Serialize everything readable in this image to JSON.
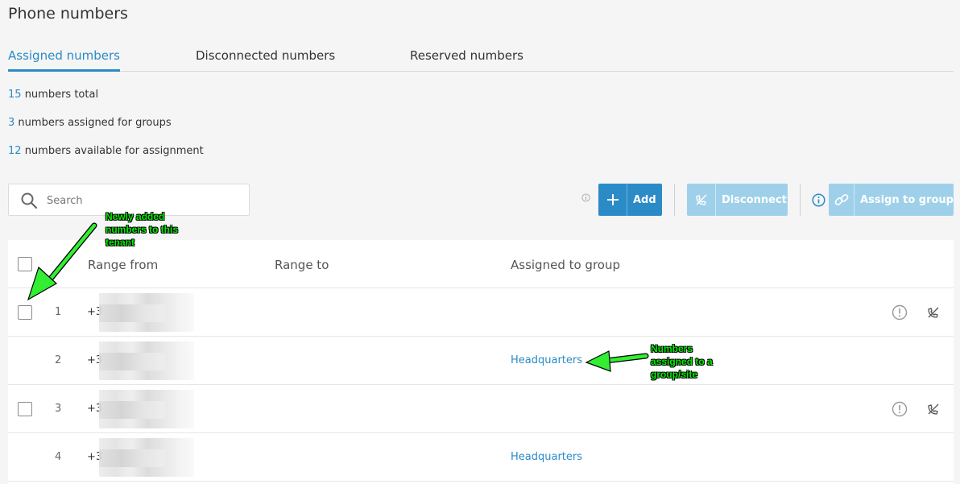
{
  "page": {
    "title": "Phone numbers"
  },
  "tabs": [
    {
      "label": "Assigned numbers",
      "active": true
    },
    {
      "label": "Disconnected numbers",
      "active": false
    },
    {
      "label": "Reserved numbers",
      "active": false
    }
  ],
  "stats": [
    {
      "value": "15",
      "text": "numbers total"
    },
    {
      "value": "3",
      "text": "numbers assigned for groups"
    },
    {
      "value": "12",
      "text": "numbers available for assignment"
    }
  ],
  "search": {
    "placeholder": "Search",
    "value": "",
    "icon": "search-icon"
  },
  "toolbar": {
    "add_label": "Add",
    "disconnect_label": "Disconnect",
    "assign_label": "Assign to group",
    "add_icon": "plus-icon",
    "disconnect_icon": "disconnect-phone-icon",
    "assign_icon": "link-icon"
  },
  "table": {
    "columns": {
      "range_from": "Range from",
      "range_to": "Range to",
      "assigned_group": "Assigned to group"
    },
    "rows": [
      {
        "index": "1",
        "range_from": "+3",
        "range_to": "",
        "group": "",
        "selectable": true
      },
      {
        "index": "2",
        "range_from": "+3",
        "range_to": "",
        "group": "Headquarters",
        "selectable": false
      },
      {
        "index": "3",
        "range_from": "+3",
        "range_to": "",
        "group": "",
        "selectable": true
      },
      {
        "index": "4",
        "range_from": "+3",
        "range_to": "",
        "group": "Headquarters",
        "selectable": false
      }
    ]
  },
  "annotations": {
    "newly_added": [
      "Newly added",
      "numbers to this",
      "tenant"
    ],
    "assigned": [
      "Numbers",
      "assigned to a",
      "group/site"
    ]
  },
  "colors": {
    "accent": "#2a8bc7",
    "disabled_button": "#9fd0ea",
    "annotation": "#00ee00"
  }
}
